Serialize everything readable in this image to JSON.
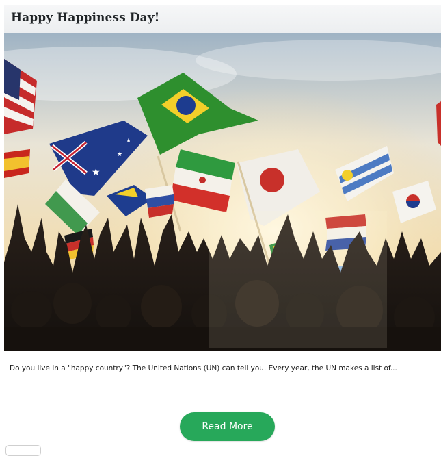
{
  "post": {
    "title": "Happy Happiness Day!",
    "image_alt": "Crowd of silhouetted people waving flags of many countries against a bright sky",
    "excerpt": "Do you live in a \"happy country\"? The United Nations (UN) can tell you. Every year, the UN makes a list of...",
    "read_more_label": "Read More"
  },
  "colors": {
    "button_bg": "#27a85a",
    "title_bar_bg": "#eceef0",
    "title_text": "#1f2326"
  },
  "icons": {
    "flags": [
      "usa-flag",
      "brazil-flag",
      "australia-flag",
      "iran-flag",
      "japan-flag",
      "uruguay-flag",
      "south-korea-flag",
      "spain-flag",
      "nigeria-flag",
      "bosnia-flag",
      "russia-flag",
      "netherlands-flag",
      "germany-flag",
      "mexico-flag",
      "argentina-flag",
      "chile-flag",
      "senegal-flag"
    ]
  }
}
